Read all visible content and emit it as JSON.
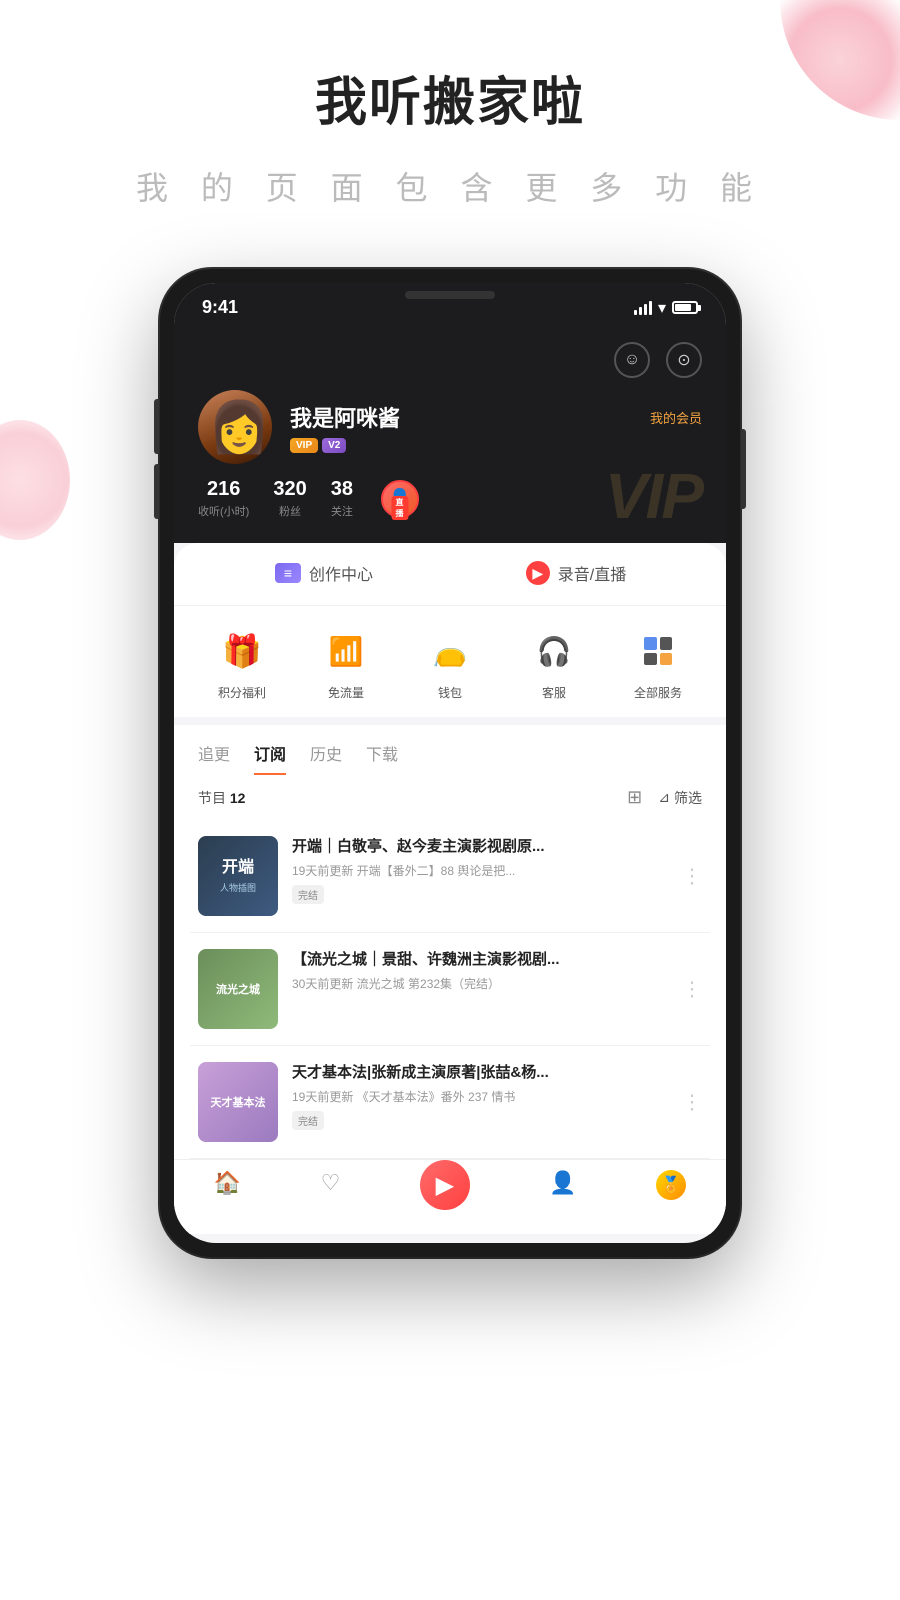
{
  "header": {
    "title": "我听搬家啦",
    "subtitle": "我 的 页 面 包 含 更 多 功 能"
  },
  "statusBar": {
    "time": "9:41",
    "signal": "signal",
    "wifi": "wifi",
    "battery": "battery"
  },
  "profile": {
    "name": "我是阿咪酱",
    "vip_link": "我的会员",
    "badge_vip": "VIP",
    "badge_v2": "V2",
    "stats": [
      {
        "number": "216",
        "label": "收听(小时)"
      },
      {
        "number": "320",
        "label": "粉丝"
      },
      {
        "number": "38",
        "label": "关注"
      }
    ],
    "live_label": "直播",
    "vip_watermark": "VIP"
  },
  "creatorTabs": [
    {
      "label": "创作中心",
      "icon": "create",
      "active": false
    },
    {
      "label": "录音/直播",
      "icon": "record",
      "active": false
    }
  ],
  "services": [
    {
      "label": "积分福利",
      "icon": "gift"
    },
    {
      "label": "免流量",
      "icon": "signal"
    },
    {
      "label": "钱包",
      "icon": "wallet"
    },
    {
      "label": "客服",
      "icon": "headset"
    },
    {
      "label": "全部服务",
      "icon": "apps"
    }
  ],
  "contentTabs": [
    {
      "label": "追更",
      "active": false
    },
    {
      "label": "订阅",
      "active": true
    },
    {
      "label": "历史",
      "active": false
    },
    {
      "label": "下载",
      "active": false
    }
  ],
  "filterBar": {
    "count_label": "节目",
    "count": "12",
    "filter_label": "筛选"
  },
  "listItems": [
    {
      "thumb_type": "1",
      "thumb_title": "开端",
      "title": "开端｜白敬亭、赵今麦主演影视剧原...",
      "meta": "19天前更新  开端【番外二】88 舆论是把...",
      "tag": "完结"
    },
    {
      "thumb_type": "2",
      "thumb_title": "流光\n之城",
      "title": "【流光之城｜景甜、许魏洲主演影视剧...",
      "meta": "30天前更新  流光之城 第232集（完结）",
      "tag": ""
    },
    {
      "thumb_type": "3",
      "thumb_title": "天才\n基本法",
      "title": "天才基本法|张新成主演原著|张喆&杨...",
      "meta": "19天前更新  《天才基本法》番外 237 情书",
      "tag": "完结"
    }
  ],
  "bottomNav": [
    {
      "label": "首页",
      "icon": "🏠",
      "active": false
    },
    {
      "label": "",
      "icon": "♡",
      "active": false
    },
    {
      "label": "",
      "icon": "▶",
      "active": false,
      "center": true
    },
    {
      "label": "",
      "icon": "👤",
      "active": false
    },
    {
      "label": "",
      "icon": "🏅",
      "active": false
    }
  ]
}
